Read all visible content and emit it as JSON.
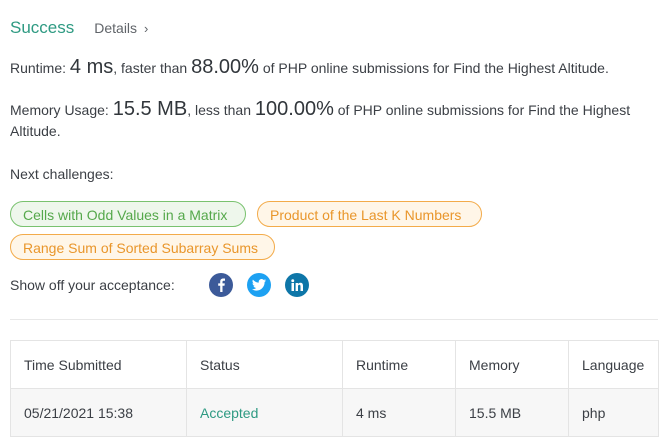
{
  "header": {
    "status": "Success",
    "details_label": "Details",
    "details_chevron": "›"
  },
  "runtime": {
    "label": "Runtime: ",
    "value": "4 ms",
    "middle": ", faster than ",
    "percent": "88.00%",
    "suffix": " of PHP online submissions for Find the Highest Altitude."
  },
  "memory": {
    "label": "Memory Usage: ",
    "value": "15.5 MB",
    "middle": ", less than ",
    "percent": "100.00%",
    "suffix": " of PHP online submissions for Find the Highest Altitude."
  },
  "next_challenges": {
    "label": "Next challenges:",
    "items": [
      {
        "label": "Cells with Odd Values in a Matrix",
        "difficulty": "easy"
      },
      {
        "label": "Product of the Last K Numbers",
        "difficulty": "medium"
      },
      {
        "label": "Range Sum of Sorted Subarray Sums",
        "difficulty": "medium"
      }
    ]
  },
  "share": {
    "label": "Show off your acceptance:",
    "icons": [
      "facebook-icon",
      "twitter-icon",
      "linkedin-icon"
    ],
    "colors": {
      "facebook": "#3c5a99",
      "twitter": "#1da1f2",
      "linkedin": "#0e76a8"
    }
  },
  "table": {
    "headers": [
      "Time Submitted",
      "Status",
      "Runtime",
      "Memory",
      "Language"
    ],
    "rows": [
      [
        "05/21/2021 15:38",
        "Accepted",
        "4 ms",
        "15.5 MB",
        "php"
      ]
    ]
  },
  "colors": {
    "success": "#2e9a82",
    "easy": "#55a84b",
    "medium": "#e9962b"
  }
}
